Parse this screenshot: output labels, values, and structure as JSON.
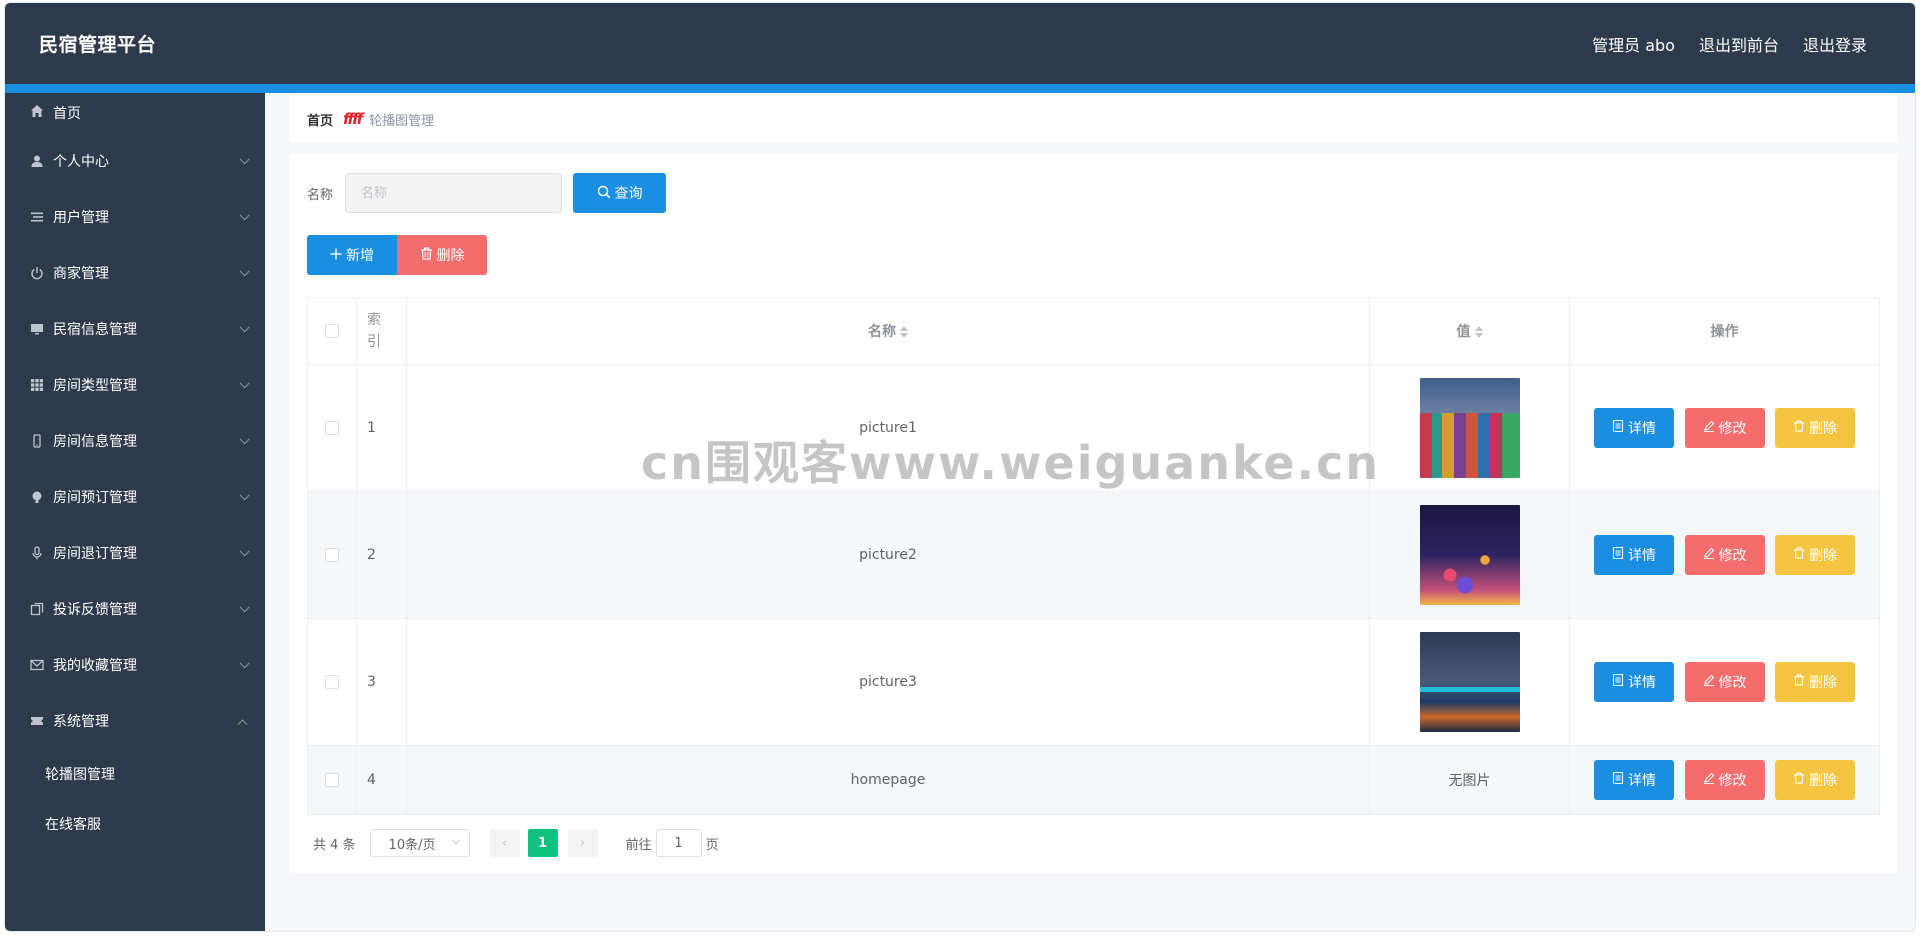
{
  "header": {
    "title": "民宿管理平台",
    "admin_label": "管理员 abo",
    "front_label": "退出到前台",
    "logout_label": "退出登录"
  },
  "sidebar": {
    "items": [
      {
        "label": "首页",
        "icon": "home-icon"
      },
      {
        "label": "个人中心",
        "icon": "user-icon"
      },
      {
        "label": "用户管理",
        "icon": "list-icon"
      },
      {
        "label": "商家管理",
        "icon": "power-icon"
      },
      {
        "label": "民宿信息管理",
        "icon": "monitor-icon"
      },
      {
        "label": "房间类型管理",
        "icon": "grid-icon"
      },
      {
        "label": "房间信息管理",
        "icon": "mobile-icon"
      },
      {
        "label": "房间预订管理",
        "icon": "bulb-icon"
      },
      {
        "label": "房间退订管理",
        "icon": "microphone-icon"
      },
      {
        "label": "投诉反馈管理",
        "icon": "copy-icon"
      },
      {
        "label": "我的收藏管理",
        "icon": "mail-icon"
      },
      {
        "label": "系统管理",
        "icon": "ticket-icon"
      }
    ],
    "sub_items": [
      "轮播图管理",
      "在线客服"
    ]
  },
  "breadcrumb": {
    "home": "首页",
    "separator": "ffff",
    "current": "轮播图管理"
  },
  "search": {
    "label": "名称",
    "placeholder": "名称",
    "query_label": "查询"
  },
  "actions": {
    "add_label": "新增",
    "delete_label": "删除"
  },
  "table": {
    "columns": {
      "index": "索引",
      "name": "名称",
      "value": "值",
      "operations": "操作"
    },
    "rows": [
      {
        "index": "1",
        "name": "picture1",
        "image": "thumb-1"
      },
      {
        "index": "2",
        "name": "picture2",
        "image": "thumb-2"
      },
      {
        "index": "3",
        "name": "picture3",
        "image": "thumb-3"
      },
      {
        "index": "4",
        "name": "homepage",
        "image": null,
        "no_image_text": "无图片"
      }
    ],
    "op_labels": {
      "detail": "详情",
      "edit": "修改",
      "delete": "删除"
    }
  },
  "pagination": {
    "total": "共 4 条",
    "page_size": "10条/页",
    "current_page": "1",
    "goto_label": "前往",
    "goto_value": "1",
    "page_suffix": "页"
  },
  "watermark": "cn围观客www.weiguanke.cn",
  "colors": {
    "header_bg": "#2d3a4b",
    "accent": "#1a8ee1",
    "danger": "#f56c6c",
    "warning": "#f5c542",
    "page_active": "#10c07f"
  }
}
